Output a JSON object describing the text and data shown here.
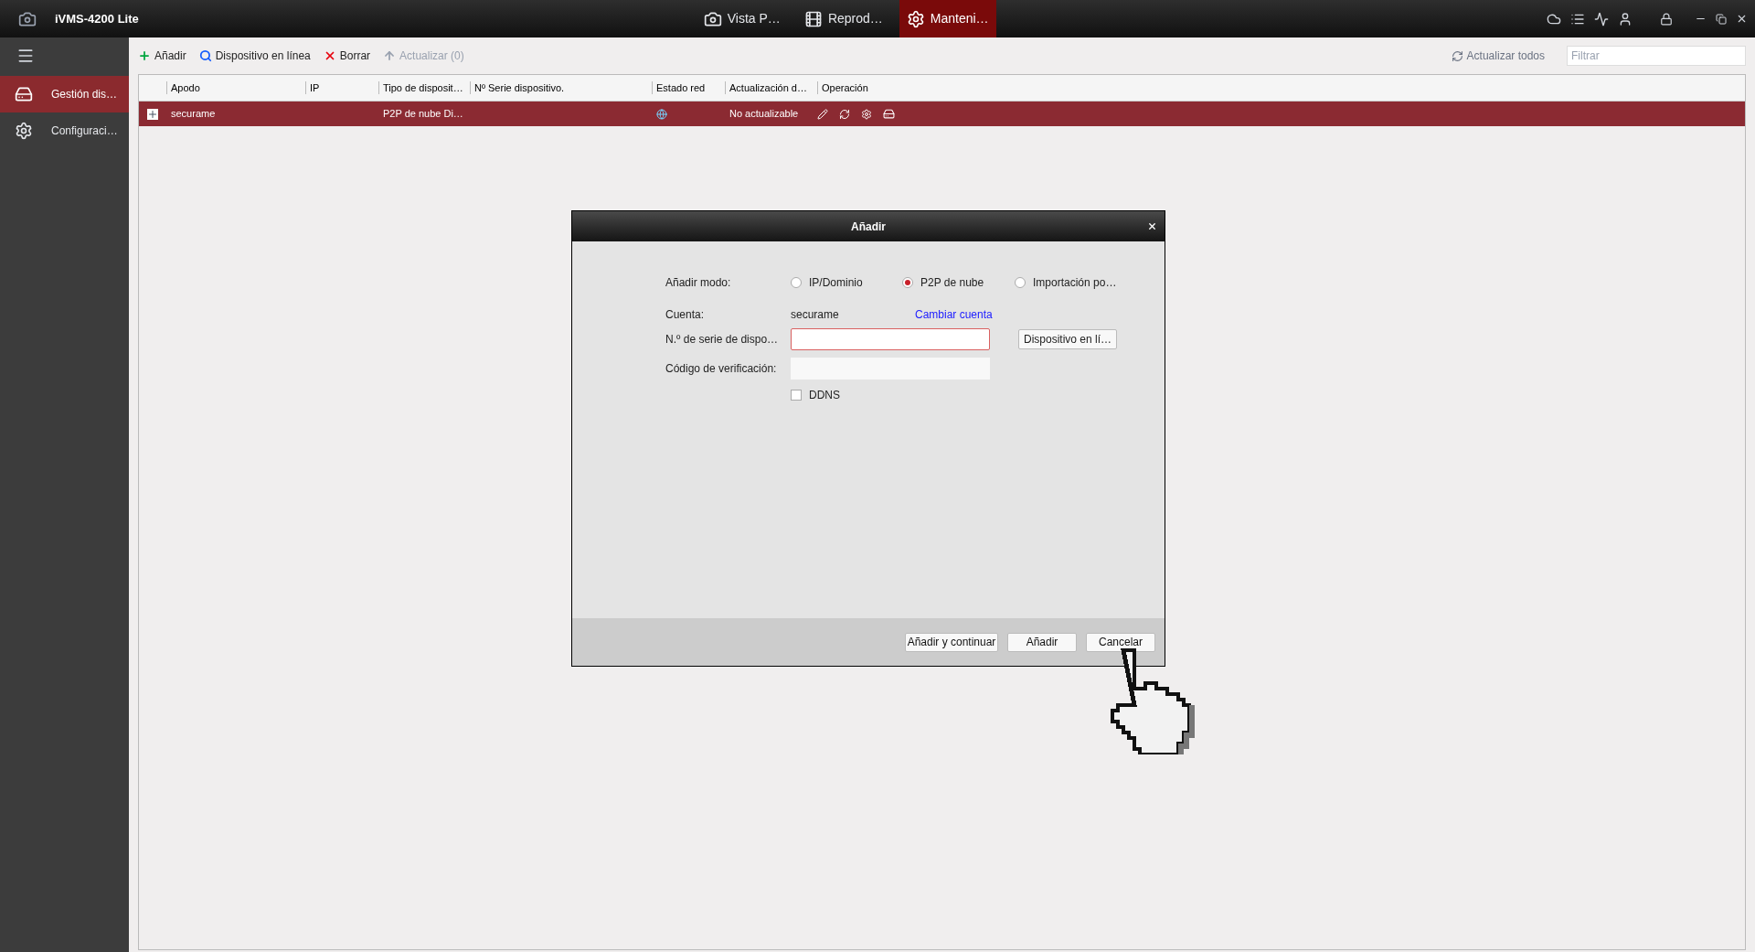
{
  "app": {
    "title": "iVMS-4200 Lite"
  },
  "top_tabs": [
    {
      "label": "Vista P…",
      "selected": false
    },
    {
      "label": "Reprod…",
      "selected": false
    },
    {
      "label": "Manteni…",
      "selected": true
    }
  ],
  "sidebar": {
    "items": [
      {
        "label": "Gestión dis…",
        "selected": true
      },
      {
        "label": "Configuraci…",
        "selected": false
      }
    ]
  },
  "toolbar": {
    "buttons": [
      {
        "label": "Añadir",
        "disabled": false
      },
      {
        "label": "Dispositivo en línea",
        "disabled": false
      },
      {
        "label": "Borrar",
        "disabled": false
      },
      {
        "label": "Actualizar (0)",
        "disabled": true
      }
    ],
    "refresh_all": "Actualizar todos",
    "filter": {
      "placeholder": "Filtrar"
    }
  },
  "table": {
    "columns": [
      "Apodo",
      "IP",
      "Tipo de disposit…",
      "Nº Serie dispositivo.",
      "Estado red",
      "Actualización d…",
      "Operación"
    ],
    "rows": [
      {
        "selected": true,
        "cells": [
          "securame",
          "",
          "P2P de nube Di…",
          "",
          "",
          "No actualizable"
        ]
      }
    ]
  },
  "dialog": {
    "title": "Añadir",
    "mode_label": "Añadir modo:",
    "modes": [
      {
        "label": "IP/Dominio",
        "selected": false
      },
      {
        "label": "P2P de nube",
        "selected": true
      },
      {
        "label": "Importación po…",
        "selected": false
      }
    ],
    "account_label": "Cuenta:",
    "account": "securame",
    "change_account": "Cambiar cuenta",
    "serial_label": "N.º de serie de dispo…",
    "online_button": "Dispositivo en lí…",
    "code_label": "Código de verificación:",
    "ddns": {
      "label": "DDNS",
      "checked": false
    },
    "buttons": [
      "Añadir y continuar",
      "Añadir",
      "Cancelar"
    ]
  }
}
